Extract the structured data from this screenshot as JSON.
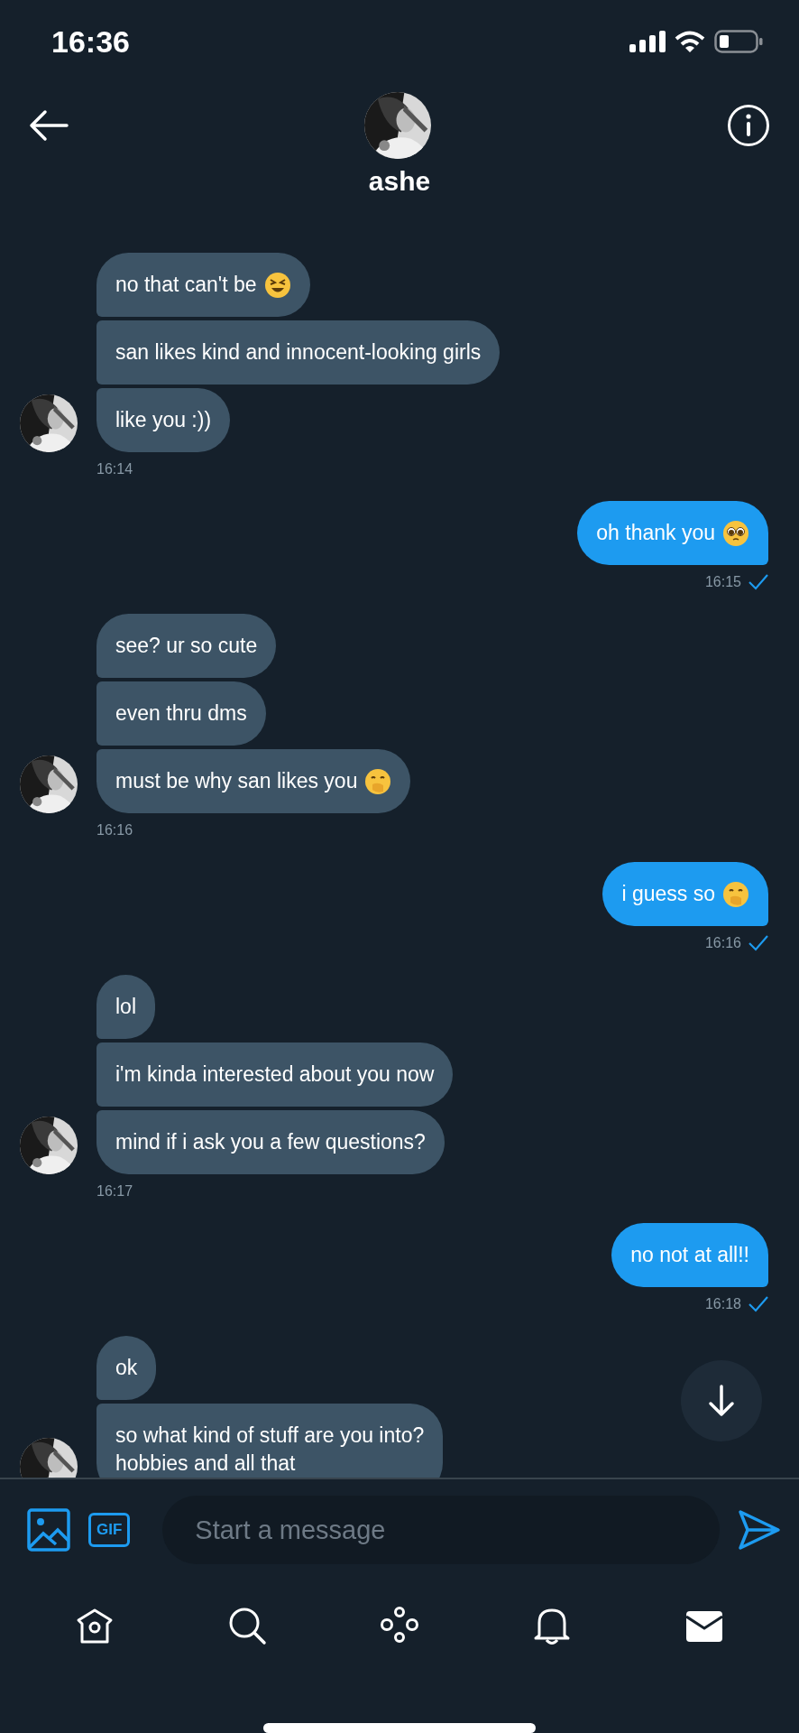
{
  "status_bar": {
    "time": "16:36"
  },
  "header": {
    "name": "ashe"
  },
  "thread": [
    {
      "kind": "incoming",
      "time": "16:14",
      "messages": [
        {
          "text": "no that can't be",
          "kind": "laughing"
        },
        {
          "text": "san likes kind and innocent-looking girls",
          "kind": "plain"
        },
        {
          "text": "like you :))",
          "kind": "plain"
        }
      ]
    },
    {
      "kind": "outgoing",
      "time": "16:15",
      "seen": true,
      "messages": [
        {
          "text": "oh thank you",
          "kind": "pleading"
        }
      ]
    },
    {
      "kind": "incoming",
      "time": "16:16",
      "messages": [
        {
          "text": "see? ur so cute",
          "kind": "plain"
        },
        {
          "text": "even thru dms",
          "kind": "plain"
        },
        {
          "text": "must be why san likes you",
          "kind": "shushing"
        }
      ]
    },
    {
      "kind": "outgoing",
      "time": "16:16",
      "seen": true,
      "messages": [
        {
          "text": "i guess so",
          "kind": "shushing"
        }
      ]
    },
    {
      "kind": "incoming",
      "time": "16:17",
      "messages": [
        {
          "text": "lol",
          "kind": "plain"
        },
        {
          "text": "i'm kinda interested about you now",
          "kind": "plain"
        },
        {
          "text": "mind if i ask you a few questions?",
          "kind": "plain"
        }
      ]
    },
    {
      "kind": "outgoing",
      "time": "16:18",
      "seen": true,
      "messages": [
        {
          "text": "no not at all!!",
          "kind": "plain"
        }
      ]
    },
    {
      "kind": "incoming",
      "messages": [
        {
          "text": "ok",
          "kind": "plain"
        },
        {
          "text": "so what kind of stuff are you into?\nhobbies and all that",
          "kind": "plain"
        }
      ]
    }
  ],
  "composer": {
    "gif_label": "GIF",
    "placeholder": "Start a message"
  },
  "nav": [
    {
      "kind": "home",
      "selected": false
    },
    {
      "kind": "search",
      "selected": false
    },
    {
      "kind": "spaces",
      "selected": false
    },
    {
      "kind": "bell",
      "selected": false
    },
    {
      "kind": "mail",
      "selected": true
    }
  ]
}
